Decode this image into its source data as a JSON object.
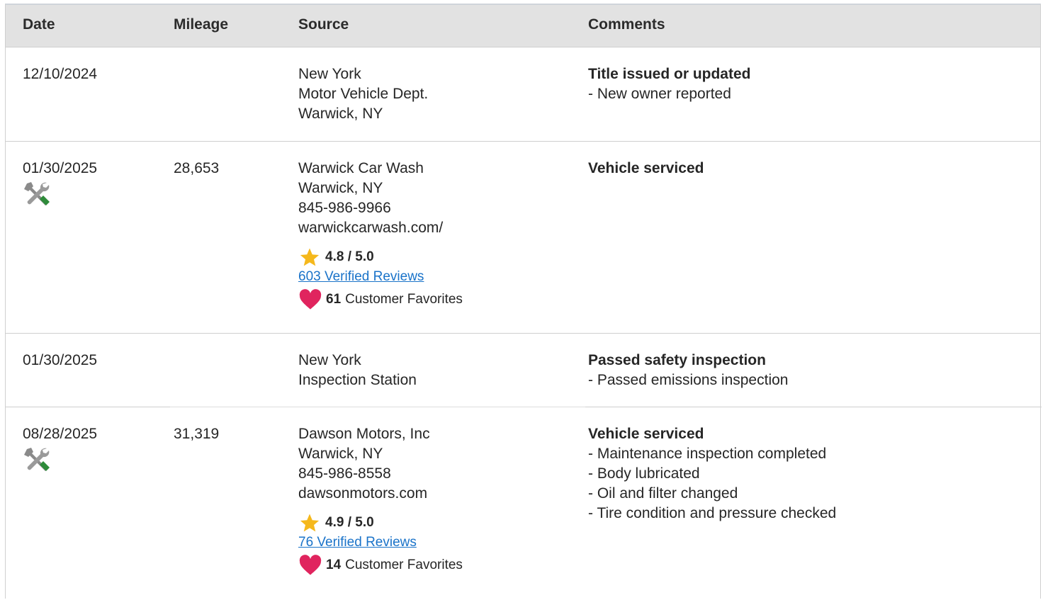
{
  "table": {
    "headers": {
      "date": "Date",
      "mileage": "Mileage",
      "source": "Source",
      "comments": "Comments"
    },
    "rows": [
      {
        "date": "12/10/2024",
        "mileage": "",
        "source_lines": [
          "New York",
          "Motor Vehicle Dept.",
          "Warwick, NY"
        ],
        "comment_title": "Title issued or updated",
        "comment_items": [
          "- New owner reported"
        ]
      },
      {
        "date": "01/30/2025",
        "service_icon": "wrench-screwdriver-icon",
        "mileage": "28,653",
        "source_lines": [
          "Warwick Car Wash",
          "Warwick, NY",
          "845-986-9966",
          "warwickcarwash.com/"
        ],
        "rating": "4.8 / 5.0",
        "reviews_link": "603 Verified Reviews",
        "favorites_count": "61",
        "favorites_label": "Customer Favorites",
        "comment_title": "Vehicle serviced",
        "comment_items": []
      },
      {
        "date": "01/30/2025",
        "mileage": "",
        "source_lines": [
          "New York",
          "Inspection Station"
        ],
        "comment_title": "Passed safety inspection",
        "comment_items": [
          "- Passed emissions inspection"
        ]
      },
      {
        "date": "08/28/2025",
        "service_icon": "wrench-screwdriver-icon",
        "mileage": "31,319",
        "source_lines": [
          "Dawson Motors, Inc",
          "Warwick, NY",
          "845-986-8558",
          "dawsonmotors.com"
        ],
        "rating": "4.9 / 5.0",
        "reviews_link": "76 Verified Reviews",
        "favorites_count": "14",
        "favorites_label": "Customer Favorites",
        "comment_title": "Vehicle serviced",
        "comment_items": [
          "- Maintenance inspection completed",
          "- Body lubricated",
          "- Oil and filter changed",
          "- Tire condition and pressure checked"
        ]
      }
    ]
  },
  "colors": {
    "header_bg": "#e2e2e2",
    "link": "#1a73c9",
    "star": "#f5b81c",
    "heart": "#e0245e",
    "service_icon_green": "#2e8b3a"
  }
}
